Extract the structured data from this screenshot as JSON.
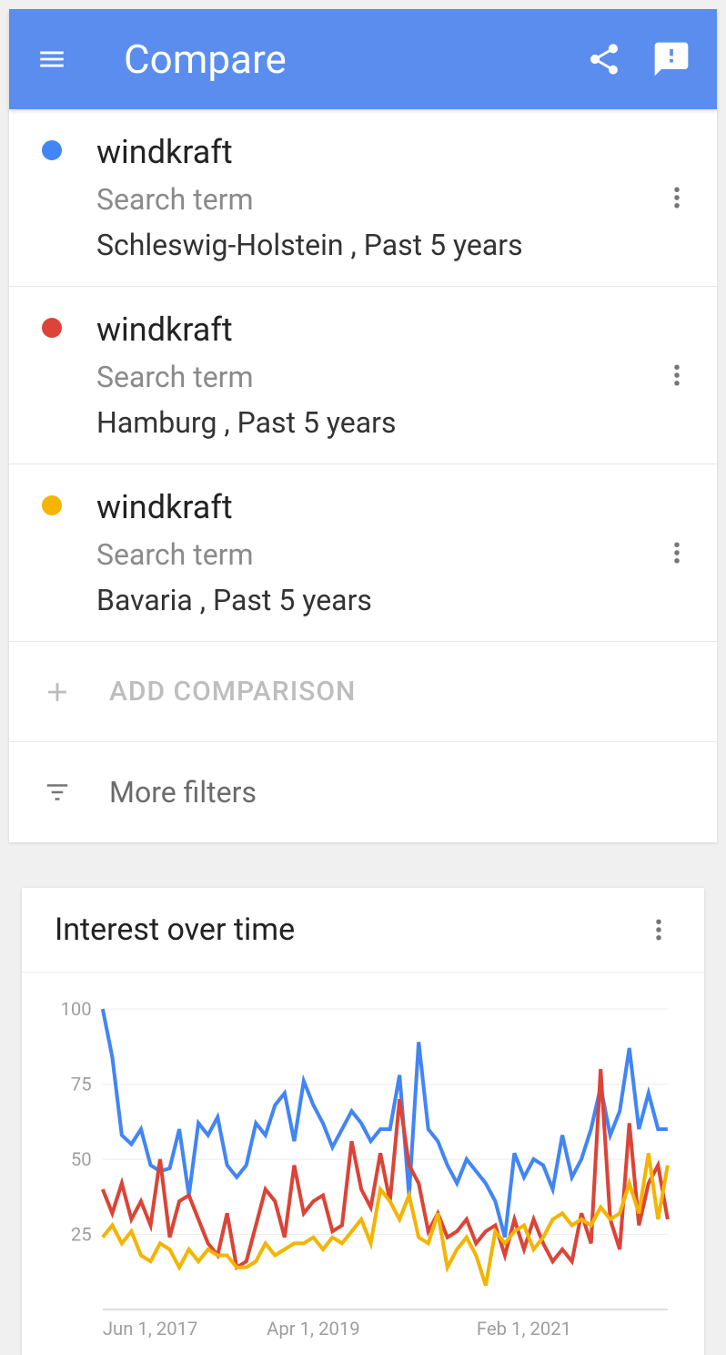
{
  "header": {
    "title": "Compare"
  },
  "terms": [
    {
      "color": "#4285f4",
      "name": "windkraft",
      "type": "Search term",
      "meta": "Schleswig-Holstein , Past 5 years"
    },
    {
      "color": "#db4437",
      "name": "windkraft",
      "type": "Search term",
      "meta": "Hamburg , Past 5 years"
    },
    {
      "color": "#f4b400",
      "name": "windkraft",
      "type": "Search term",
      "meta": "Bavaria , Past 5 years"
    }
  ],
  "add_comparison_label": "ADD COMPARISON",
  "more_filters_label": "More filters",
  "chart": {
    "title": "Interest over time"
  },
  "chart_data": {
    "type": "line",
    "title": "Interest over time",
    "xlabel": "",
    "ylabel": "",
    "ylim": [
      0,
      100
    ],
    "yticks": [
      25,
      50,
      75,
      100
    ],
    "xticks_indices": [
      0,
      22,
      44
    ],
    "xticks_labels": [
      "Jun 1, 2017",
      "Apr 1, 2019",
      "Feb 1, 2021"
    ],
    "n_points": 60,
    "series": [
      {
        "name": "Schleswig-Holstein",
        "color": "#4285f4",
        "values": [
          100,
          84,
          58,
          55,
          60,
          48,
          46,
          47,
          60,
          38,
          62,
          58,
          64,
          48,
          44,
          48,
          62,
          58,
          68,
          72,
          56,
          76,
          68,
          62,
          54,
          60,
          66,
          62,
          56,
          60,
          60,
          78,
          38,
          89,
          60,
          56,
          48,
          42,
          50,
          46,
          42,
          36,
          24,
          52,
          44,
          50,
          48,
          40,
          58,
          44,
          50,
          60,
          74,
          58,
          66,
          87,
          60,
          72,
          60,
          60
        ]
      },
      {
        "name": "Hamburg",
        "color": "#db4437",
        "values": [
          40,
          32,
          42,
          30,
          36,
          28,
          50,
          24,
          36,
          38,
          30,
          22,
          18,
          32,
          14,
          16,
          28,
          40,
          36,
          24,
          48,
          32,
          36,
          38,
          26,
          28,
          56,
          40,
          34,
          52,
          36,
          70,
          48,
          42,
          26,
          32,
          24,
          26,
          30,
          22,
          26,
          28,
          18,
          30,
          20,
          30,
          22,
          16,
          20,
          16,
          32,
          22,
          80,
          30,
          20,
          62,
          28,
          42,
          48,
          30
        ]
      },
      {
        "name": "Bavaria",
        "color": "#f4b400",
        "values": [
          24,
          28,
          22,
          26,
          18,
          16,
          22,
          20,
          14,
          20,
          16,
          20,
          18,
          18,
          14,
          14,
          16,
          22,
          18,
          20,
          22,
          22,
          24,
          20,
          24,
          22,
          26,
          30,
          22,
          40,
          36,
          30,
          38,
          24,
          22,
          32,
          14,
          20,
          24,
          18,
          8,
          26,
          22,
          26,
          28,
          20,
          24,
          30,
          32,
          28,
          30,
          28,
          34,
          30,
          32,
          42,
          32,
          52,
          30,
          48
        ]
      }
    ]
  }
}
